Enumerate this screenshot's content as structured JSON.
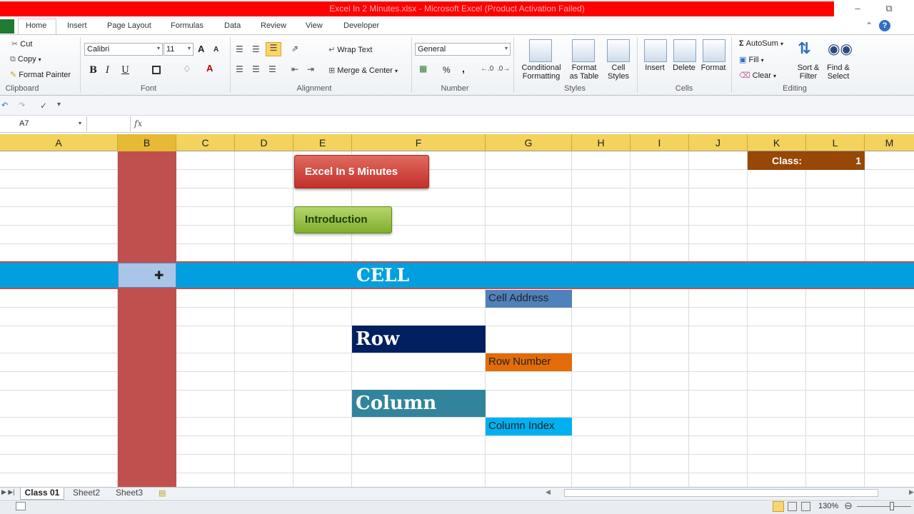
{
  "window": {
    "title": "Excel In 2 Minutes.xlsx  -  Microsoft Excel (Product Activation Failed)"
  },
  "ribbon": {
    "tabs": [
      "Home",
      "Insert",
      "Page Layout",
      "Formulas",
      "Data",
      "Review",
      "View",
      "Developer"
    ],
    "clipboard": {
      "cut": "Cut",
      "copy": "Copy",
      "format_painter": "Format Painter",
      "group": "Clipboard"
    },
    "font": {
      "name": "Calibri",
      "size": "11",
      "bold": "B",
      "italic": "I",
      "underline": "U",
      "grow": "A",
      "shrink": "A",
      "color": "A",
      "group": "Font"
    },
    "alignment": {
      "wrap_text": "Wrap Text",
      "merge_center": "Merge & Center",
      "group": "Alignment"
    },
    "number": {
      "format": "General",
      "percent": "%",
      "comma": ",",
      "group": "Number"
    },
    "styles": {
      "conditional": "Conditional",
      "conditional2": "Formatting",
      "format_table": "Format",
      "format_table2": "as Table",
      "cell_styles": "Cell",
      "cell_styles2": "Styles",
      "group": "Styles"
    },
    "cells": {
      "insert": "Insert",
      "delete": "Delete",
      "format": "Format",
      "group": "Cells"
    },
    "editing": {
      "autosum": "AutoSum",
      "fill": "Fill",
      "clear": "Clear",
      "sort": "Sort &",
      "sort2": "Filter",
      "find": "Find &",
      "find2": "Select",
      "group": "Editing"
    }
  },
  "formula_bar": {
    "name_box": "A7",
    "fx": "fx",
    "value": ""
  },
  "columns": [
    "A",
    "B",
    "C",
    "D",
    "E",
    "F",
    "G",
    "H",
    "I",
    "J",
    "K",
    "L",
    "M"
  ],
  "sheet": {
    "btn_excel": "Excel In 5 Minutes",
    "btn_intro": "Introduction",
    "class_label": "Class:",
    "class_value": "1",
    "band_cell": "CELL",
    "label_cell_address": "Cell Address",
    "band_row": "Row",
    "label_row_number": "Row Number",
    "band_column": "Column",
    "label_column_index": "Column Index",
    "colors": {
      "col_b": "#c0504d",
      "cell_band": "#00a0e0",
      "row_band": "#002060",
      "column_band": "#31849b",
      "cell_address": "#4f81bd",
      "row_number": "#e36c09",
      "column_index": "#00b0f0",
      "class_box": "#974706",
      "header": "#f3d25d"
    }
  },
  "sheet_tabs": [
    "Class 01",
    "Sheet2",
    "Sheet3"
  ],
  "status": {
    "zoom": "130%"
  }
}
